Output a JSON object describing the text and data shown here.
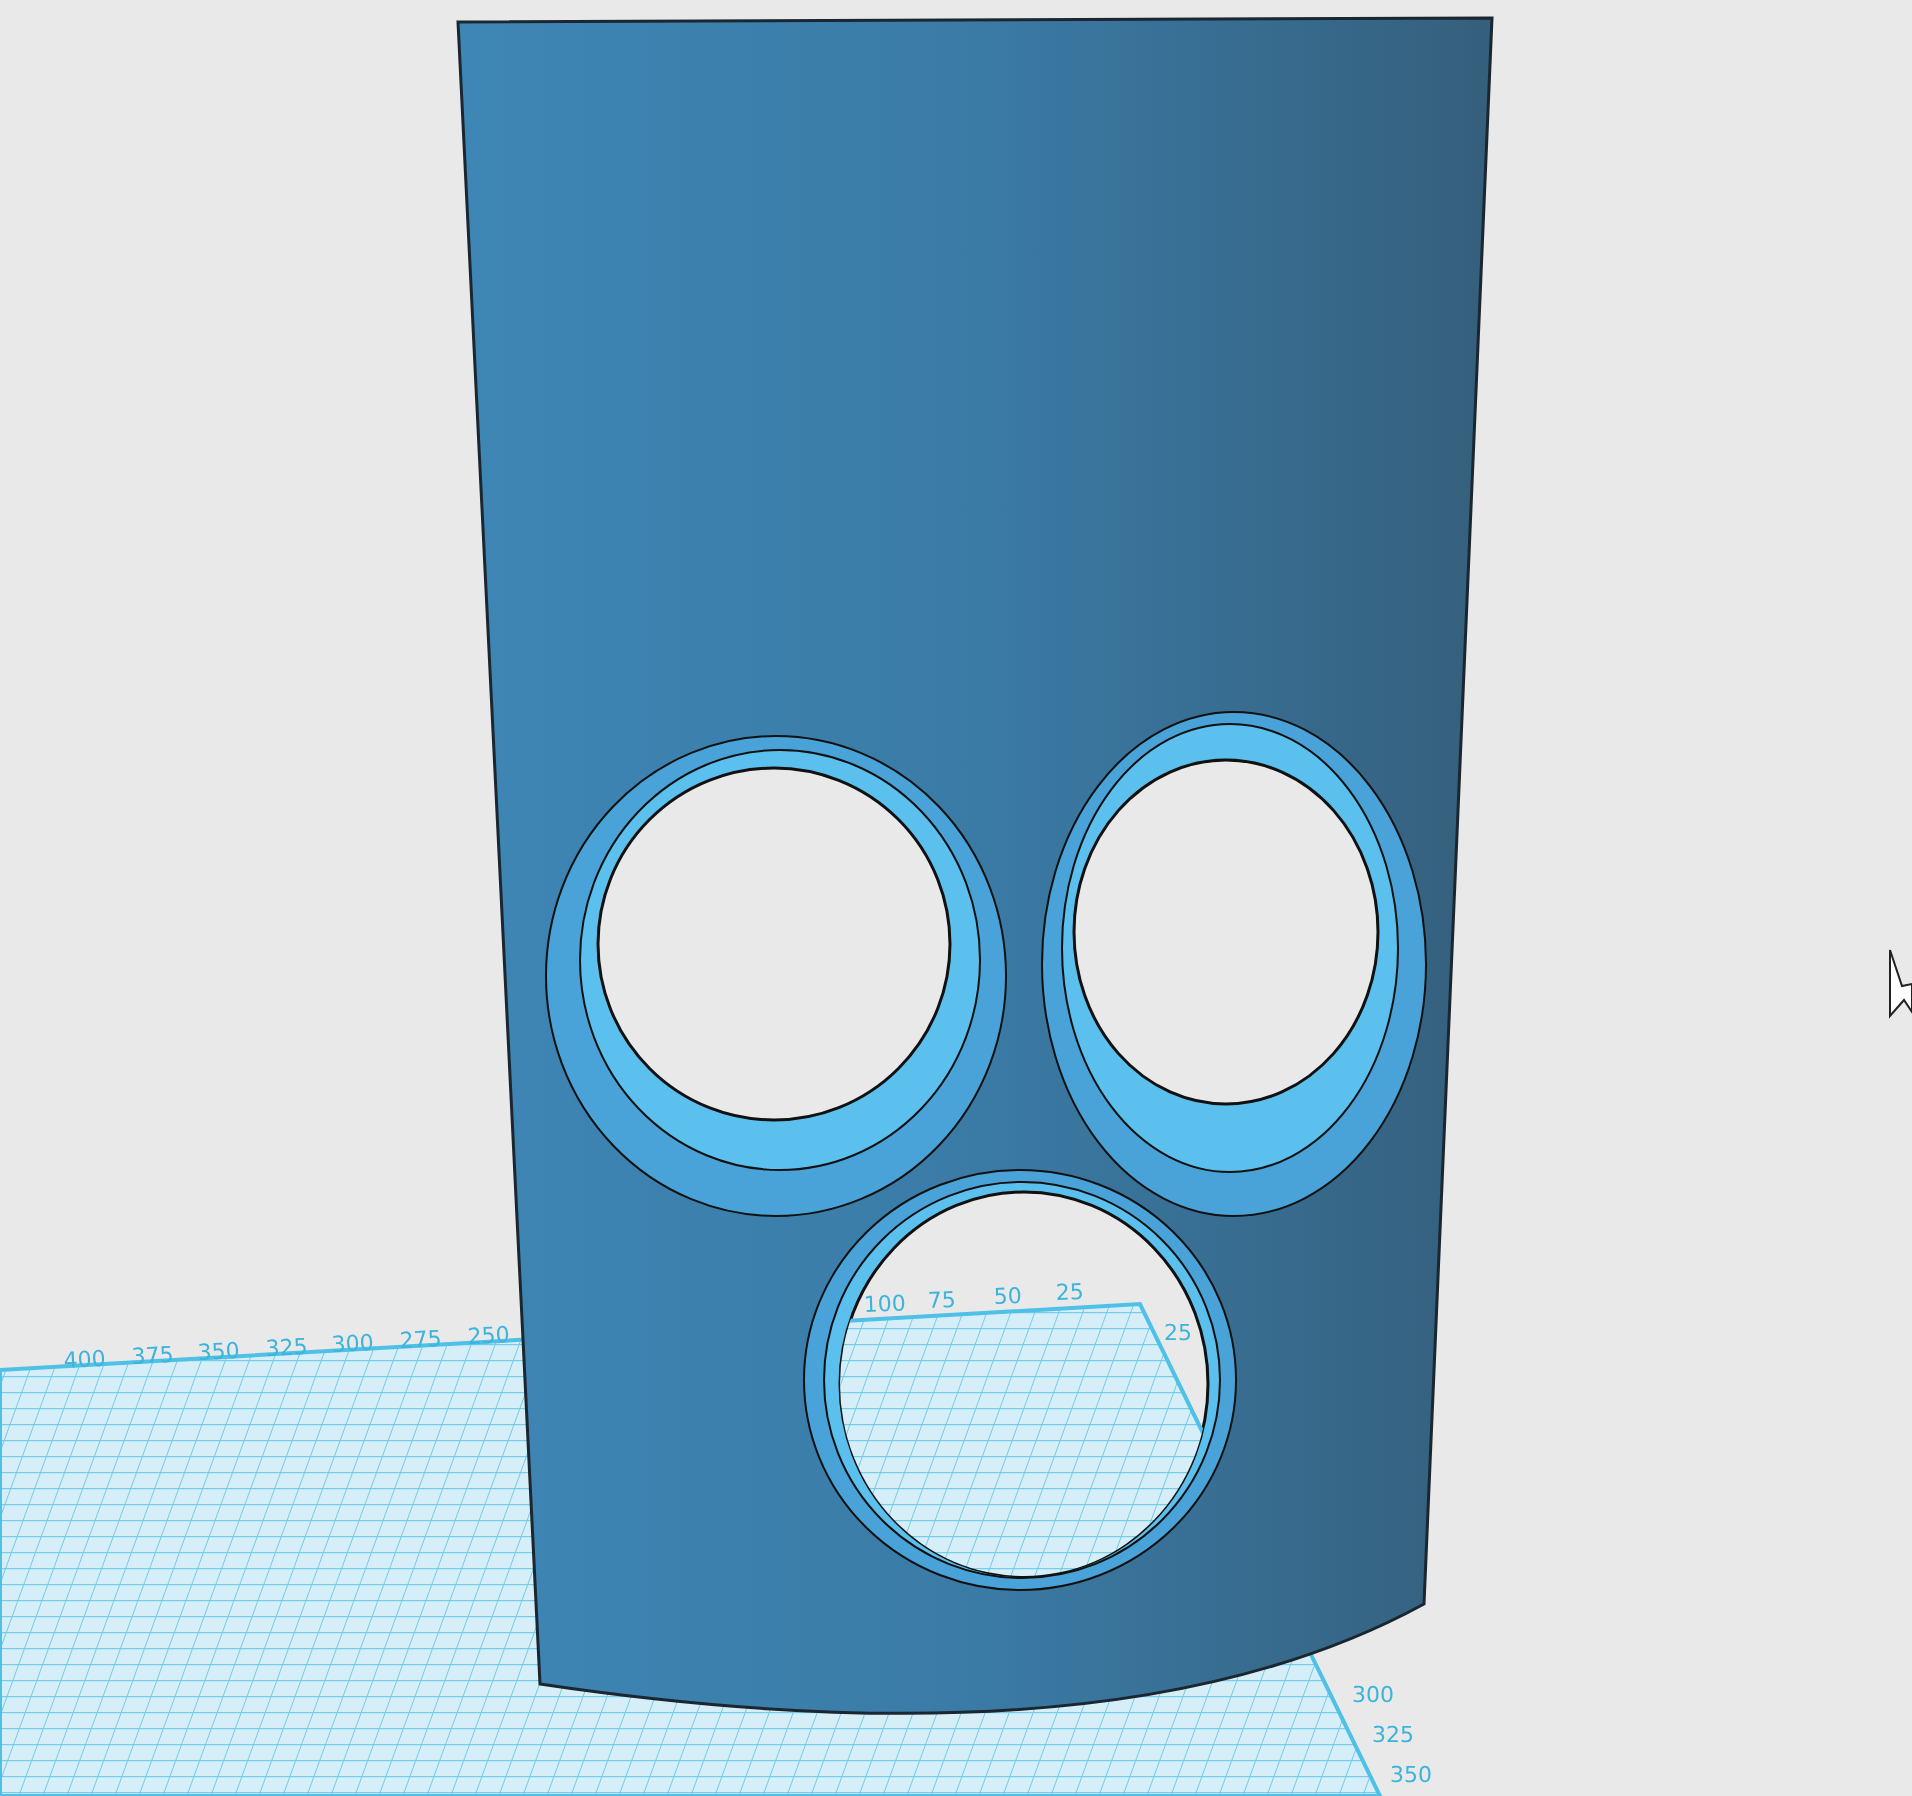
{
  "viewport": {
    "grid_labels": [
      "400",
      "375",
      "350",
      "325",
      "300",
      "275",
      "250",
      "100",
      "75",
      "50",
      "25",
      "25",
      "300",
      "325",
      "350"
    ]
  }
}
